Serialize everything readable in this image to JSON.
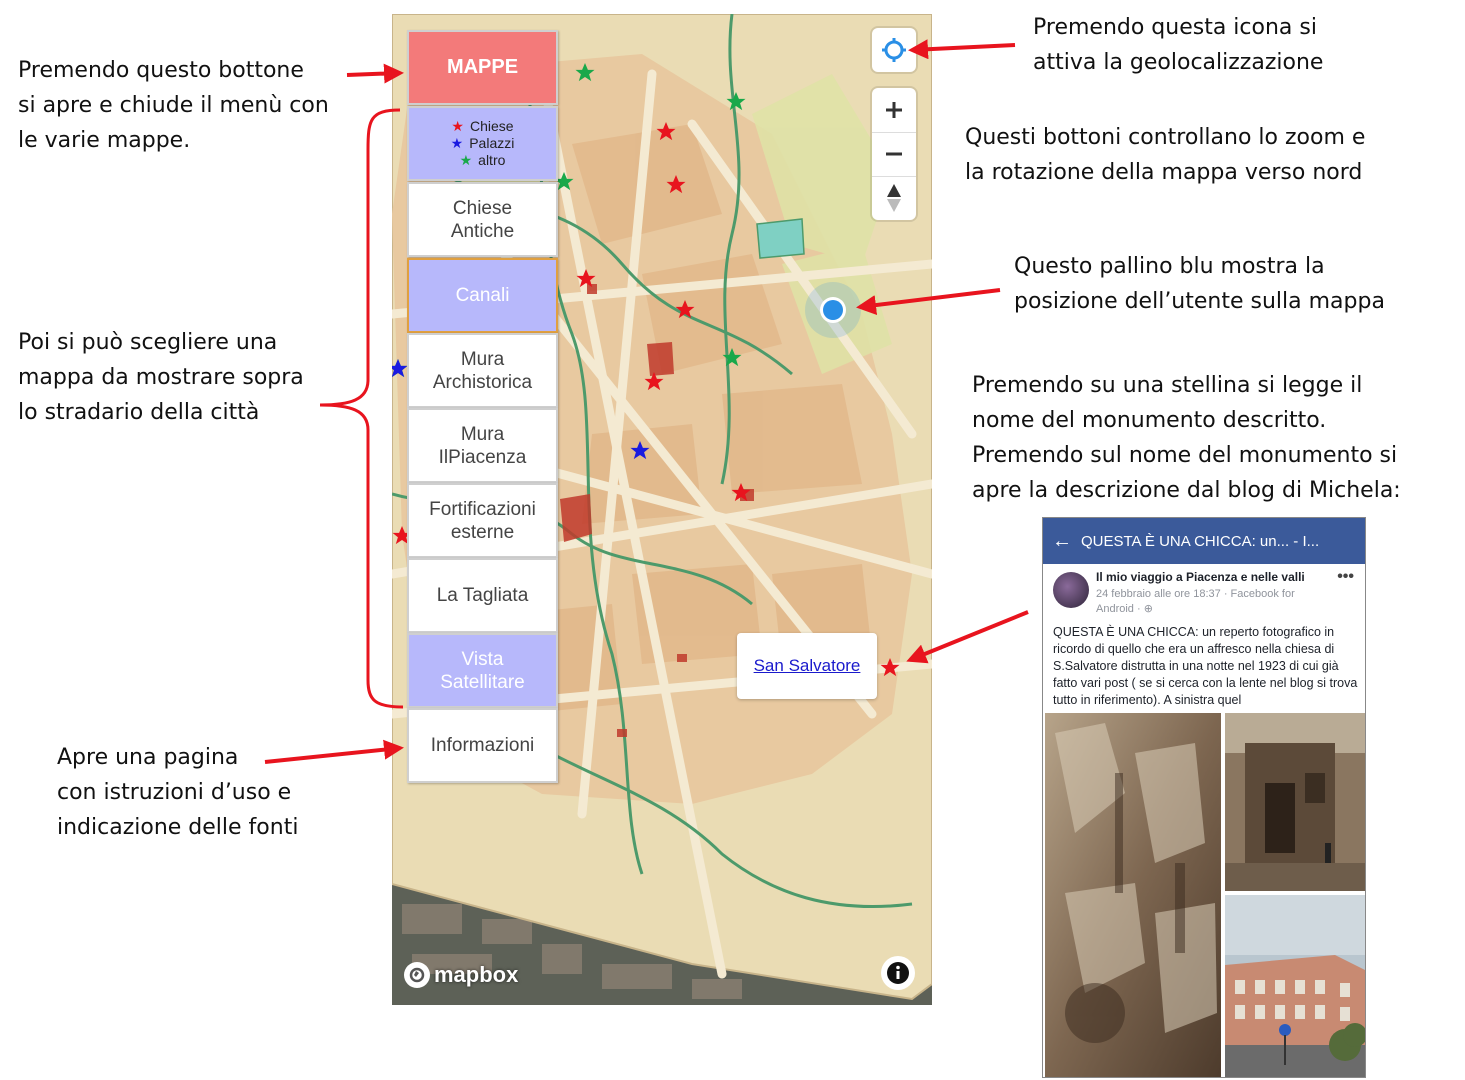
{
  "annotations": {
    "menu_button": [
      "Premendo questo bottone",
      "si apre e chiude il menù con",
      "le varie mappe."
    ],
    "choose_map": [
      "Poi si può scegliere una",
      "mappa da mostrare sopra",
      "lo stradario della città"
    ],
    "info_page": [
      "Apre una pagina",
      "con istruzioni d’uso e",
      "indicazione delle fonti"
    ],
    "geolocation": [
      "Premendo questa icona si",
      "attiva la geolocalizzazione"
    ],
    "zoom": [
      "Questi bottoni controllano lo zoom e",
      "la rotazione della mappa verso nord"
    ],
    "user_dot": [
      "Questo pallino blu mostra la",
      "posizione dell’utente sulla mappa"
    ],
    "stars": [
      "Premendo su una stellina si legge il",
      "nome del monumento descritto.",
      "Premendo sul nome del monumento si",
      "apre la descrizione dal blog di Michela:"
    ]
  },
  "menu": {
    "mappe": "MAPPE",
    "legend": [
      {
        "label": "Chiese",
        "color": "#e8141e"
      },
      {
        "label": "Palazzi",
        "color": "#1a1ae0"
      },
      {
        "label": "altro",
        "color": "#19a84a"
      }
    ],
    "items": [
      {
        "label": "Chiese\nAntiche",
        "style": "white"
      },
      {
        "label": "Canali",
        "style": "lavender"
      },
      {
        "label": "Mura\nArchistorica",
        "style": "white"
      },
      {
        "label": "Mura\nIlPiacenza",
        "style": "white"
      },
      {
        "label": "Fortificazioni\nesterne",
        "style": "white"
      },
      {
        "label": "La Tagliata",
        "style": "white"
      },
      {
        "label": "Vista\nSatellitare",
        "style": "lavender"
      },
      {
        "label": "Informazioni",
        "style": "white"
      }
    ]
  },
  "map": {
    "popup_link": "San Salvatore",
    "attribution": "mapbox",
    "star_colors": {
      "church": "#e8141e",
      "palace": "#1a1ae0",
      "other": "#19a84a"
    },
    "user_dot_color": "#2a8fe6"
  },
  "facebook_post": {
    "title": "QUESTA È UNA CHICCA: un... - I...",
    "author": "Il mio viaggio a Piacenza e nelle valli",
    "meta": "24 febbraio alle ore 18:37 · Facebook for Android · ",
    "text": "QUESTA È UNA CHICCA: un reperto fotografico in ricordo di quello che era un affresco nella chiesa di S.Salvatore distrutta in una notte nel 1923 di cui già fatto vari post ( se si cerca con la lente nel blog si trova tutto in riferimento). A sinistra quel",
    "bar_color": "#3b5a9a"
  },
  "colors": {
    "arrow": "#e8141e",
    "menu_red": "#f37a7a",
    "menu_lavender": "#b7b8fb"
  }
}
